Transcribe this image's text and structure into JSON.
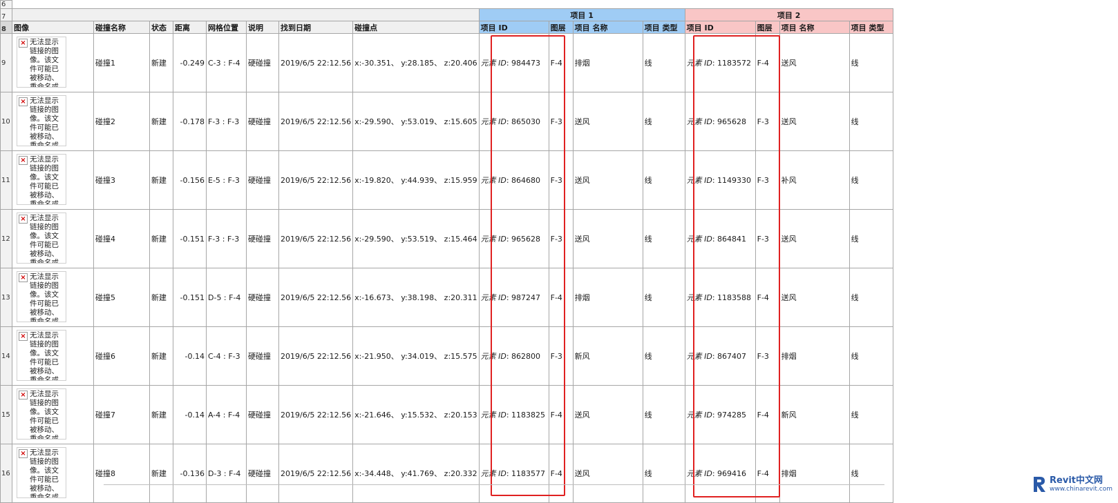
{
  "sheet": {
    "top_row_numbers": [
      "6",
      "7",
      "8"
    ],
    "group1_label": "项目 1",
    "group2_label": "项目 2",
    "headers": {
      "image": "图像",
      "clash_name": "碰撞名称",
      "status": "状态",
      "distance": "距离",
      "grid": "网格位置",
      "desc": "说明",
      "date": "找到日期",
      "point": "碰撞点",
      "item_id_1": "项目 ID",
      "layer_1": "图层",
      "item_name_1": "项目 名称",
      "item_type_1": "项目 类型",
      "item_id_2": "项目 ID",
      "layer_2": "图层",
      "item_name_2": "项目 名称",
      "item_type_2": "项目 类型"
    },
    "broken_image_text": "无法显示链接的图像。该文件可能已被移动、重命名或",
    "element_id_prefix": "元素 ID",
    "rows": [
      {
        "rownum": "9",
        "name": "碰撞1",
        "status": "新建",
        "distance": "-0.249",
        "grid": "C-3 : F-4",
        "desc": "硬碰撞",
        "date": "2019/6/5  22:12.56",
        "point": "x:-30.351、 y:28.185、 z:20.406",
        "id1": ": 984473",
        "layer1": "F-4",
        "iname1": "排烟",
        "itype1": "线",
        "id2": ": 1183572",
        "layer2": "F-4",
        "iname2": "送风",
        "itype2": "线"
      },
      {
        "rownum": "10",
        "name": "碰撞2",
        "status": "新建",
        "distance": "-0.178",
        "grid": "F-3 : F-3",
        "desc": "硬碰撞",
        "date": "2019/6/5  22:12.56",
        "point": "x:-29.590、 y:53.019、 z:15.605",
        "id1": ": 865030",
        "layer1": "F-3",
        "iname1": "送风",
        "itype1": "线",
        "id2": ": 965628",
        "layer2": "F-3",
        "iname2": "送风",
        "itype2": "线"
      },
      {
        "rownum": "11",
        "name": "碰撞3",
        "status": "新建",
        "distance": "-0.156",
        "grid": "E-5 : F-3",
        "desc": "硬碰撞",
        "date": "2019/6/5  22:12.56",
        "point": "x:-19.820、 y:44.939、 z:15.959",
        "id1": ": 864680",
        "layer1": "F-3",
        "iname1": "送风",
        "itype1": "线",
        "id2": ": 1149330",
        "layer2": "F-3",
        "iname2": "补风",
        "itype2": "线"
      },
      {
        "rownum": "12",
        "name": "碰撞4",
        "status": "新建",
        "distance": "-0.151",
        "grid": "F-3 : F-3",
        "desc": "硬碰撞",
        "date": "2019/6/5  22:12.56",
        "point": "x:-29.590、 y:53.519、 z:15.464",
        "id1": ": 965628",
        "layer1": "F-3",
        "iname1": "送风",
        "itype1": "线",
        "id2": ": 864841",
        "layer2": "F-3",
        "iname2": "送风",
        "itype2": "线"
      },
      {
        "rownum": "13",
        "name": "碰撞5",
        "status": "新建",
        "distance": "-0.151",
        "grid": "D-5 : F-4",
        "desc": "硬碰撞",
        "date": "2019/6/5  22:12.56",
        "point": "x:-16.673、 y:38.198、 z:20.311",
        "id1": ": 987247",
        "layer1": "F-4",
        "iname1": "排烟",
        "itype1": "线",
        "id2": ": 1183588",
        "layer2": "F-4",
        "iname2": "送风",
        "itype2": "线"
      },
      {
        "rownum": "14",
        "name": "碰撞6",
        "status": "新建",
        "distance": "-0.14",
        "grid": "C-4 : F-3",
        "desc": "硬碰撞",
        "date": "2019/6/5  22:12.56",
        "point": "x:-21.950、 y:34.019、 z:15.575",
        "id1": ": 862800",
        "layer1": "F-3",
        "iname1": "新风",
        "itype1": "线",
        "id2": ": 867407",
        "layer2": "F-3",
        "iname2": "排烟",
        "itype2": "线"
      },
      {
        "rownum": "15",
        "name": "碰撞7",
        "status": "新建",
        "distance": "-0.14",
        "grid": "A-4 : F-4",
        "desc": "硬碰撞",
        "date": "2019/6/5  22:12.56",
        "point": "x:-21.646、 y:15.532、 z:20.153",
        "id1": ": 1183825",
        "layer1": "F-4",
        "iname1": "送风",
        "itype1": "线",
        "id2": ": 974285",
        "layer2": "F-4",
        "iname2": "新风",
        "itype2": "线"
      },
      {
        "rownum": "16",
        "name": "碰撞8",
        "status": "新建",
        "distance": "-0.136",
        "grid": "D-3 : F-4",
        "desc": "硬碰撞",
        "date": "2019/6/5  22:12.56",
        "point": "x:-34.448、 y:41.769、 z:20.332",
        "id1": ": 1183577",
        "layer1": "F-4",
        "iname1": "送风",
        "itype1": "线",
        "id2": ": 969416",
        "layer2": "F-4",
        "iname2": "排烟",
        "itype2": "线"
      }
    ]
  },
  "colors": {
    "group1": "#9fccf5",
    "group2": "#f9c6c6",
    "highlight_box": "#e02020"
  },
  "watermark": {
    "title": "Revit中文网",
    "url": "www.chinarevit.com"
  }
}
